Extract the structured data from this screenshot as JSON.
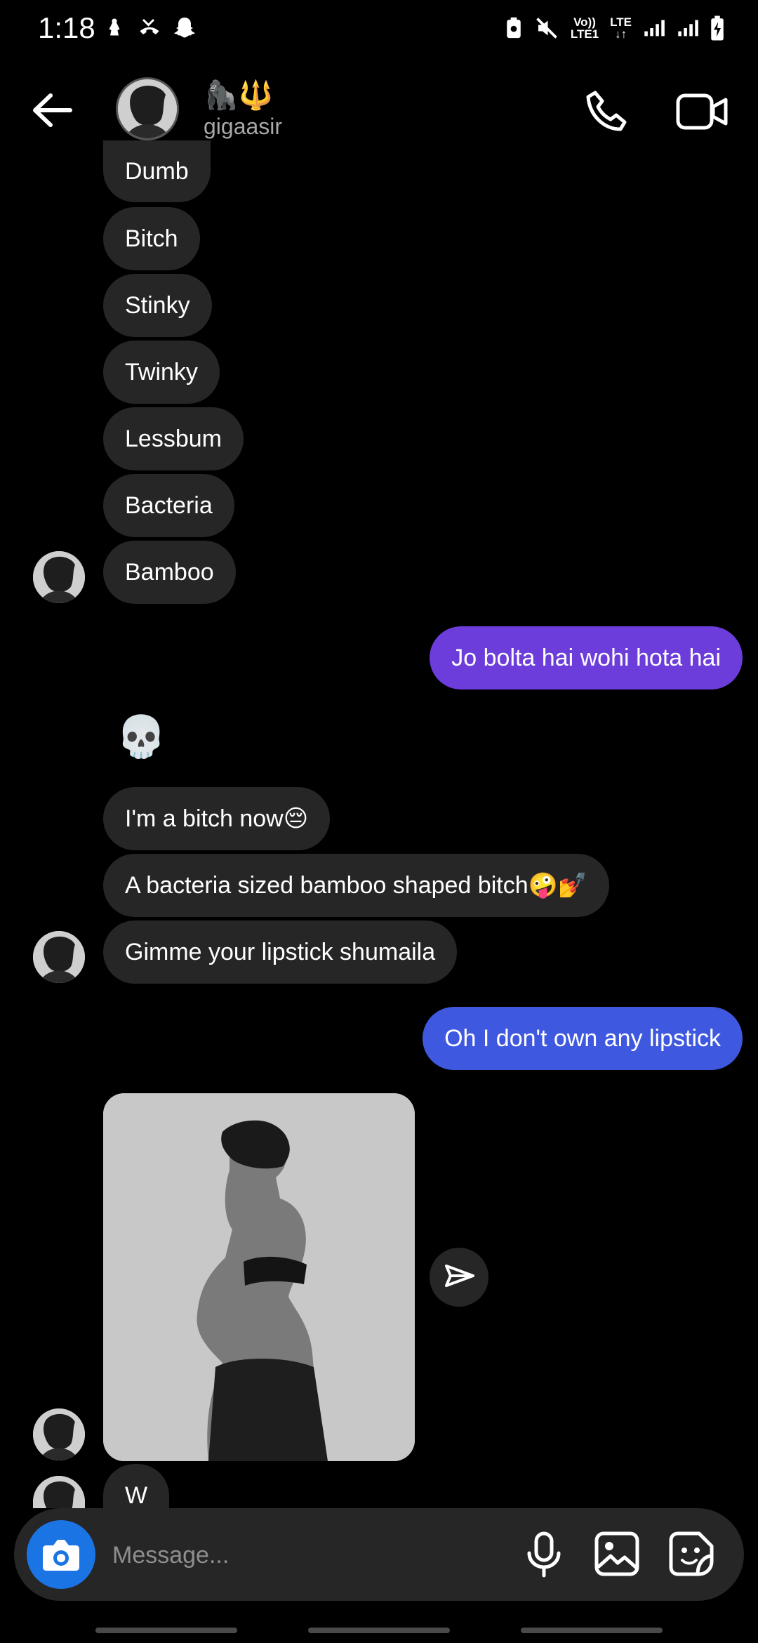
{
  "status_bar": {
    "time": "1:18",
    "network_top": "Vo))",
    "network_bottom": "LTE1",
    "lte": "LTE"
  },
  "header": {
    "emoji": "🦍🔱",
    "username": "gigaasir"
  },
  "messages_incoming_top": [
    {
      "text": "Dumb"
    },
    {
      "text": "Bitch"
    },
    {
      "text": "Stinky"
    },
    {
      "text": "Twinky"
    },
    {
      "text": "Lessbum"
    },
    {
      "text": "Bacteria"
    },
    {
      "text": "Bamboo"
    }
  ],
  "message_out_1": {
    "text": "Jo bolta hai wohi hota hai",
    "color": "#6c3ddb"
  },
  "skull_emoji": "💀",
  "messages_incoming_mid": [
    {
      "text": "I'm a bitch now😔"
    },
    {
      "text": "A bacteria sized bamboo shaped bitch🤪💅"
    },
    {
      "text": "Gimme your lipstick shumaila"
    }
  ],
  "message_out_2": {
    "text": "Oh I don't own any lipstick",
    "color": "#3f58e0"
  },
  "message_last": {
    "text": "W"
  },
  "composer": {
    "placeholder": "Message...",
    "camera_color": "#1b74e4"
  },
  "icons": {
    "back": "arrow-left-icon",
    "call": "phone-icon",
    "video": "video-camera-icon",
    "share": "paper-plane-icon",
    "camera": "camera-icon",
    "mic": "microphone-icon",
    "gallery": "image-icon",
    "sticker": "sticker-icon"
  }
}
